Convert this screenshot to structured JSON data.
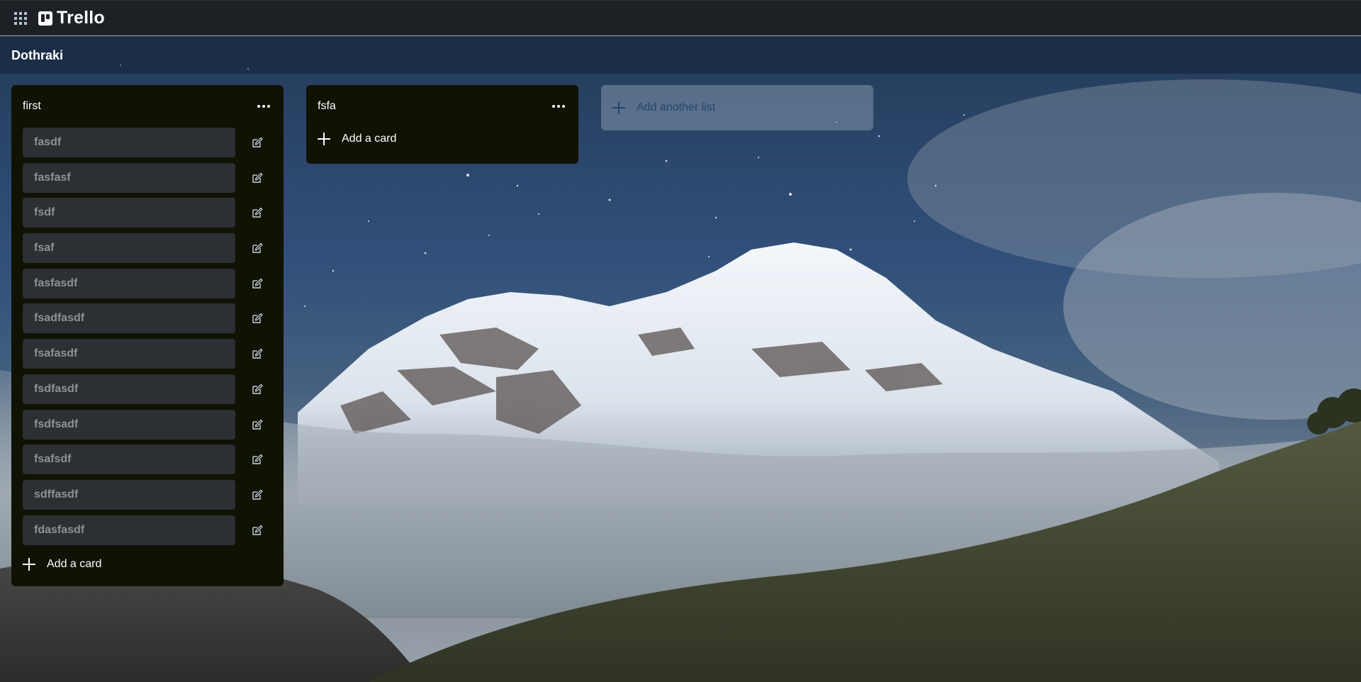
{
  "app": {
    "name": "Trello",
    "apps_icon": "grid-icon",
    "logo_icon": "trello-logo-icon"
  },
  "board": {
    "title": "Dothraki"
  },
  "lists": [
    {
      "title": "first",
      "cards": [
        {
          "title": "fasdf"
        },
        {
          "title": "fasfasf"
        },
        {
          "title": "fsdf"
        },
        {
          "title": "fsaf"
        },
        {
          "title": "fasfasdf"
        },
        {
          "title": "fsadfasdf"
        },
        {
          "title": "fsafasdf"
        },
        {
          "title": "fsdfasdf"
        },
        {
          "title": "fsdfsadf"
        },
        {
          "title": "fsafsdf"
        },
        {
          "title": "sdffasdf"
        },
        {
          "title": "fdasfasdf"
        }
      ],
      "add_card_label": "Add a card"
    },
    {
      "title": "fsfa",
      "cards": [],
      "add_card_label": "Add a card"
    }
  ],
  "add_list_label": "Add another list",
  "icons": {
    "card_edit": "pencil-icon",
    "list_menu": "more-horizontal-icon",
    "add": "plus-icon"
  },
  "colors": {
    "topbar": "#1d2125",
    "list_bg": "#101204",
    "card_bg": "#2c2f33",
    "card_text": "#8c9398",
    "add_list_text": "#24456b"
  }
}
